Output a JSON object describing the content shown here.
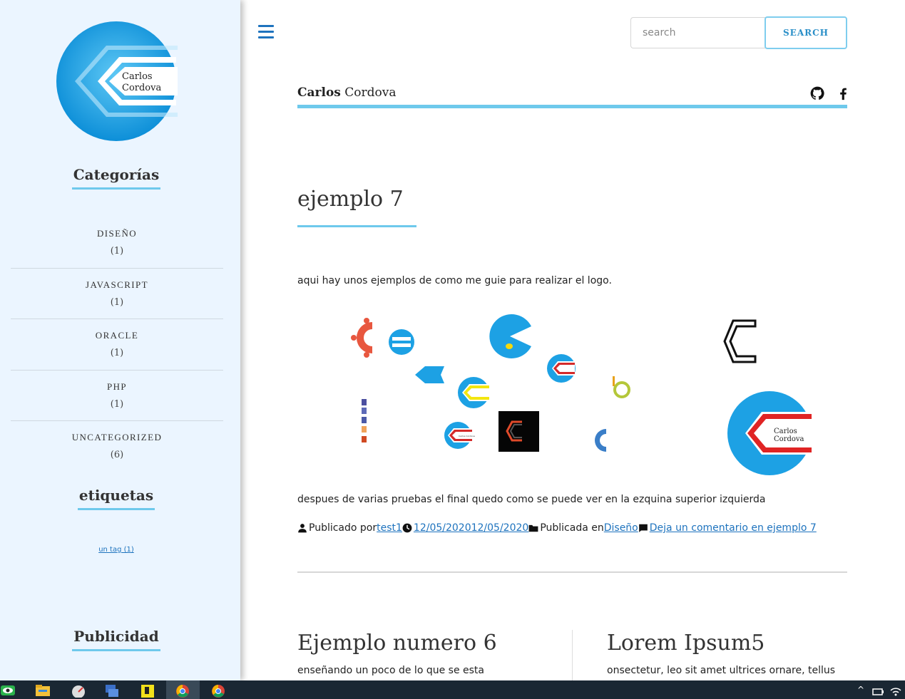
{
  "sidebar": {
    "logo_text": [
      "Carlos",
      "Cordova"
    ],
    "categories_heading": "Categorías",
    "categories": [
      {
        "name": "DISEÑO",
        "count": "(1)"
      },
      {
        "name": "JAVASCRIPT",
        "count": "(1)"
      },
      {
        "name": "ORACLE",
        "count": "(1)"
      },
      {
        "name": "PHP",
        "count": "(1)"
      },
      {
        "name": "UNCATEGORIZED",
        "count": "(6)"
      }
    ],
    "tags_heading": "etiquetas",
    "tag": "un tag (1)",
    "ads_heading": "Publicidad"
  },
  "header": {
    "menu_icon": "hamburger-icon",
    "search_placeholder": "search",
    "search_button": "SEARCH",
    "site_title_bold": "Carlos",
    "site_title_rest": "Cordova",
    "social_icons": [
      "github-icon",
      "facebook-icon"
    ]
  },
  "post": {
    "title": "ejemplo 7",
    "intro": "aqui hay unos ejemplos de como me guie para realizar el logo.",
    "gallery_logo_text": [
      "Carlos",
      "Cordova"
    ],
    "gallery_small_text": "Carlos Cordova",
    "outro": "despues de varias pruebas el final quedo como se puede ver en la ezquina superior izquierda",
    "meta": {
      "posted_by_label": "Publicado por",
      "author": "test1",
      "dates": "12/05/202012/05/2020",
      "published_in_label": "Publicada en",
      "category": "Diseño",
      "comment_link": "Deja un comentario en ejemplo 7"
    }
  },
  "cards": [
    {
      "title": "Ejemplo numero 6",
      "excerpt": "enseñando un poco de lo que se esta"
    },
    {
      "title": "Lorem Ipsum5",
      "excerpt": "onsectetur, leo sit amet ultrices ornare, tellus"
    }
  ],
  "colors": {
    "accent": "#6ec9ec",
    "link": "#1e73be",
    "sidebar_bg": "#ebf5ff",
    "logo_blue": "#1da1e4",
    "taskbar": "#1a2733"
  }
}
